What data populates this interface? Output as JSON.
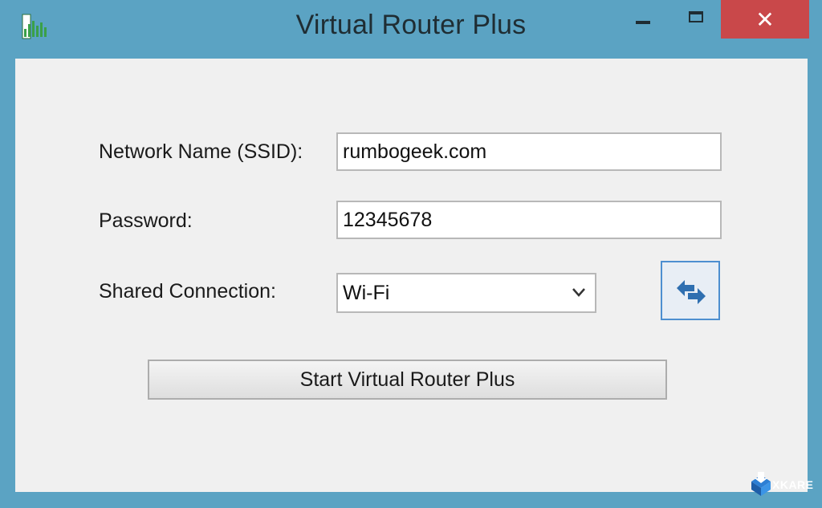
{
  "window": {
    "title": "Virtual Router Plus",
    "close_glyph": "✕"
  },
  "form": {
    "ssid_label": "Network Name (SSID):",
    "ssid_value": "rumbogeek.com",
    "password_label": "Password:",
    "password_value": "12345678",
    "shared_label": "Shared Connection:",
    "shared_value": "Wi-Fi",
    "start_button_label": "Start Virtual Router Plus"
  },
  "icons": {
    "app": "signal-bars-icon",
    "minimize": "minimize-icon",
    "maximize": "maximize-icon",
    "close": "close-icon",
    "dropdown": "chevron-down-icon",
    "refresh": "refresh-arrows-icon"
  },
  "colors": {
    "frame": "#5ba3c3",
    "close_button": "#c9484a",
    "client_bg": "#f0f0f0",
    "focus_border": "#4d8fd0"
  },
  "watermark": {
    "text": "XKARE"
  }
}
